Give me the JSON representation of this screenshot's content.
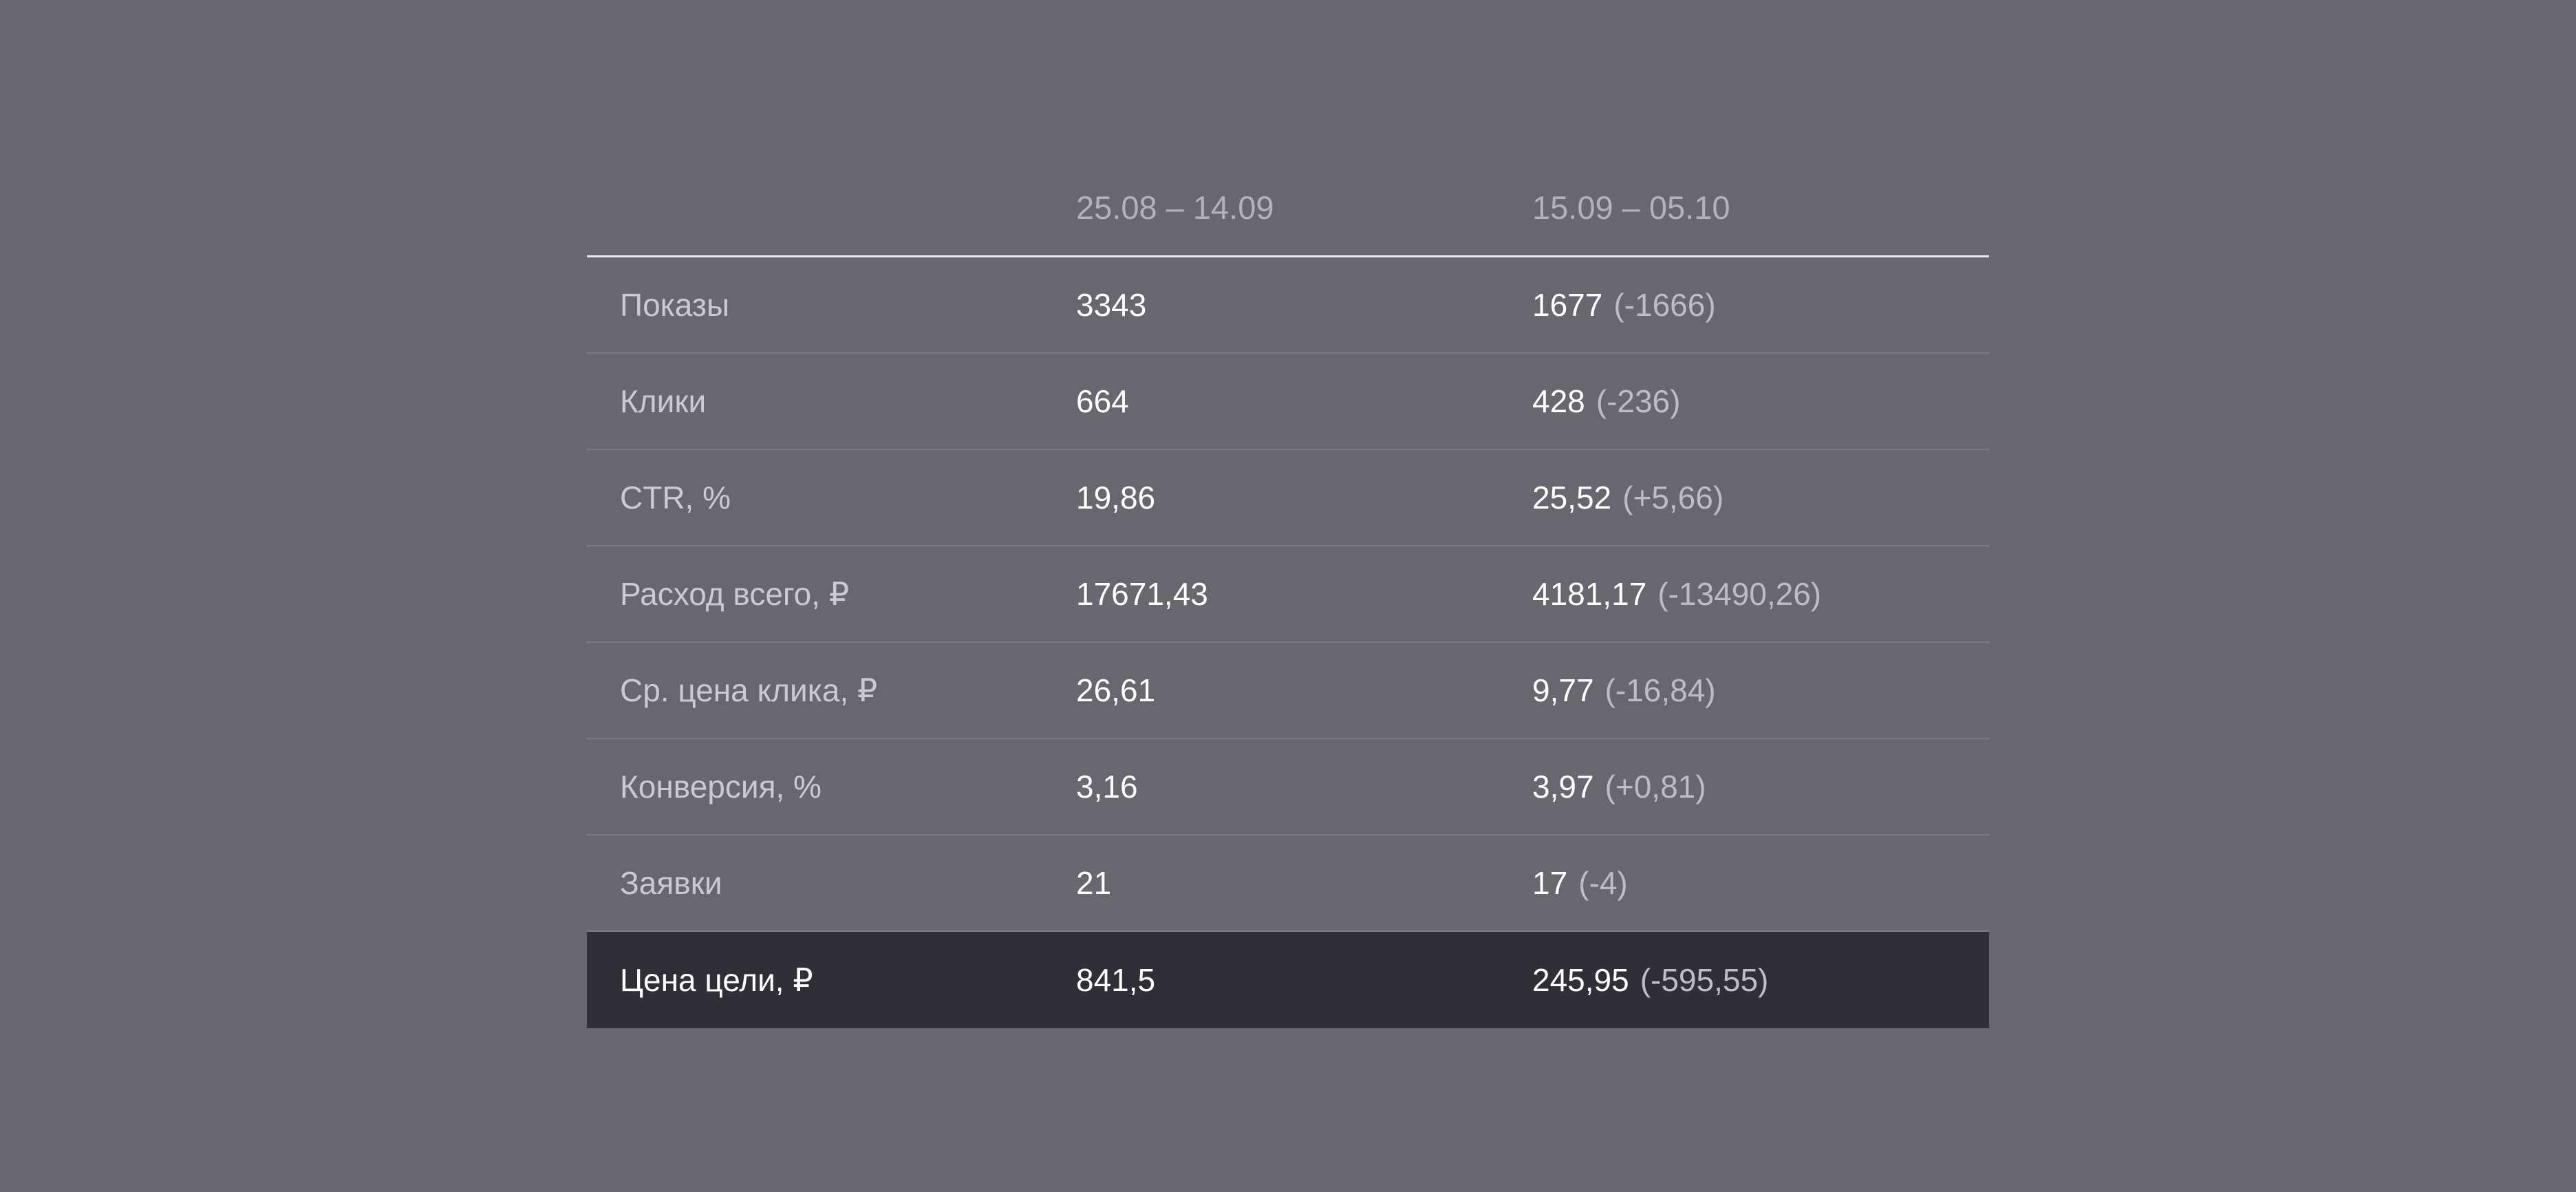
{
  "columns": {
    "metric": "",
    "period1": "25.08 – 14.09",
    "period2": "15.09 – 05.10"
  },
  "rows": [
    {
      "label": "Показы",
      "v1": "3343",
      "v2": "1677",
      "delta": "(-1666)"
    },
    {
      "label": "Клики",
      "v1": "664",
      "v2": "428",
      "delta": "(-236)"
    },
    {
      "label": "CTR, %",
      "v1": "19,86",
      "v2": "25,52",
      "delta": "(+5,66)"
    },
    {
      "label": "Расход всего, ₽",
      "v1": "17671,43",
      "v2": "4181,17",
      "delta": "(-13490,26)"
    },
    {
      "label": "Ср. цена клика, ₽",
      "v1": "26,61",
      "v2": "9,77",
      "delta": "(-16,84)"
    },
    {
      "label": "Конверсия, %",
      "v1": "3,16",
      "v2": "3,97",
      "delta": "(+0,81)"
    },
    {
      "label": "Заявки",
      "v1": "21",
      "v2": "17",
      "delta": "(-4)"
    },
    {
      "label": "Цена цели, ₽",
      "v1": "841,5",
      "v2": "245,95",
      "delta": "(-595,55)",
      "highlight": true
    }
  ],
  "colors": {
    "background": "#68666f",
    "highlight_row": "#302e37",
    "header_text": "#b4b2b9",
    "label_text": "#ccc9d0",
    "value_text": "#ffffff",
    "delta_text": "#bebcc4"
  }
}
